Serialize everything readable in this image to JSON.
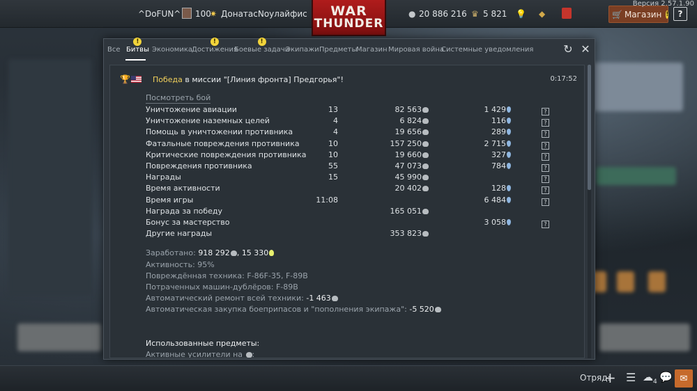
{
  "topbar": {
    "version": "Версия 2.57.1.90",
    "nickname": "^DoFUN^",
    "level": "100",
    "player_name": "ДонатасNoулайфис",
    "silver_lions": "20 886 216",
    "golden_eagles": "5 821",
    "shop_label": "Магазин",
    "logo_line1": "WAR",
    "logo_line2": "THUNDER",
    "help": "?"
  },
  "tabs": [
    {
      "label": "Все",
      "active": false,
      "warning": false
    },
    {
      "label": "Битвы",
      "active": true,
      "warning": true
    },
    {
      "label": "Экономика",
      "active": false,
      "warning": false
    },
    {
      "label": "Достижения",
      "active": false,
      "warning": true
    },
    {
      "label": "Боевые задачи",
      "active": false,
      "warning": true
    },
    {
      "label": "Экипажи",
      "active": false,
      "warning": false
    },
    {
      "label": "Предметы",
      "active": false,
      "warning": false
    },
    {
      "label": "Магазин",
      "active": false,
      "warning": false
    },
    {
      "label": "Мировая война",
      "active": false,
      "warning": false
    },
    {
      "label": "Системные уведомления",
      "active": false,
      "warning": false
    }
  ],
  "message": {
    "victory": "Победа",
    "mission_text": " в миссии \"[Линия фронта] Предгорья\"!",
    "time": "0:17:52",
    "view_battle": "Посмотреть бой"
  },
  "rows": [
    {
      "label": "Уничтожение авиации",
      "count": "13",
      "silver": "82 563",
      "rp": "1 429",
      "q": true
    },
    {
      "label": "Уничтожение наземных целей",
      "count": "4",
      "silver": "6 824",
      "rp": "116",
      "q": true
    },
    {
      "label": "Помощь в уничтожении противника",
      "count": "4",
      "silver": "19 656",
      "rp": "289",
      "q": true
    },
    {
      "label": "Фатальные повреждения противника",
      "count": "10",
      "silver": "157 250",
      "rp": "2 715",
      "q": true
    },
    {
      "label": "Критические повреждения противника",
      "count": "10",
      "silver": "19 660",
      "rp": "327",
      "q": true
    },
    {
      "label": "Повреждения противника",
      "count": "55",
      "silver": "47 073",
      "rp": "784",
      "q": true
    },
    {
      "label": "Награды",
      "count": "15",
      "silver": "45 990",
      "rp": "",
      "q": true
    },
    {
      "label": "Время активности",
      "count": "",
      "silver": "20 402",
      "rp": "128",
      "q": true
    },
    {
      "label": "Время игры",
      "count": "11:08",
      "silver": "",
      "rp": "6 484",
      "q": true
    },
    {
      "label": "Награда за победу",
      "count": "",
      "silver": "165 051",
      "rp": "",
      "q": false
    },
    {
      "label": "Бонус за мастерство",
      "count": "",
      "silver": "",
      "rp": "3 058",
      "q": true
    },
    {
      "label": "Другие награды",
      "count": "",
      "silver": "353 823",
      "rp": "",
      "q": false
    }
  ],
  "summary": {
    "earned_label": "Заработано: ",
    "earned_silver": "918 292",
    "earned_sep": ", ",
    "earned_rp": "15 330",
    "activity": "Активность: 95%",
    "damaged": "Повреждённая техника: F-86F-35, F-89B",
    "backups": "Потраченных машин-дублёров: F-89B",
    "repair_label": "Автоматический ремонт всей техники: ",
    "repair_value": "-1 463",
    "ammo_label": "Автоматическая закупка боеприпасов и \"пополнения экипажа\": ",
    "ammo_value": "-5 520",
    "used_items": "Использованные предметы:",
    "boosters": "Активные усилители на "
  },
  "bottombar": {
    "squad_label": "Отряд:",
    "friends_count": "4"
  }
}
